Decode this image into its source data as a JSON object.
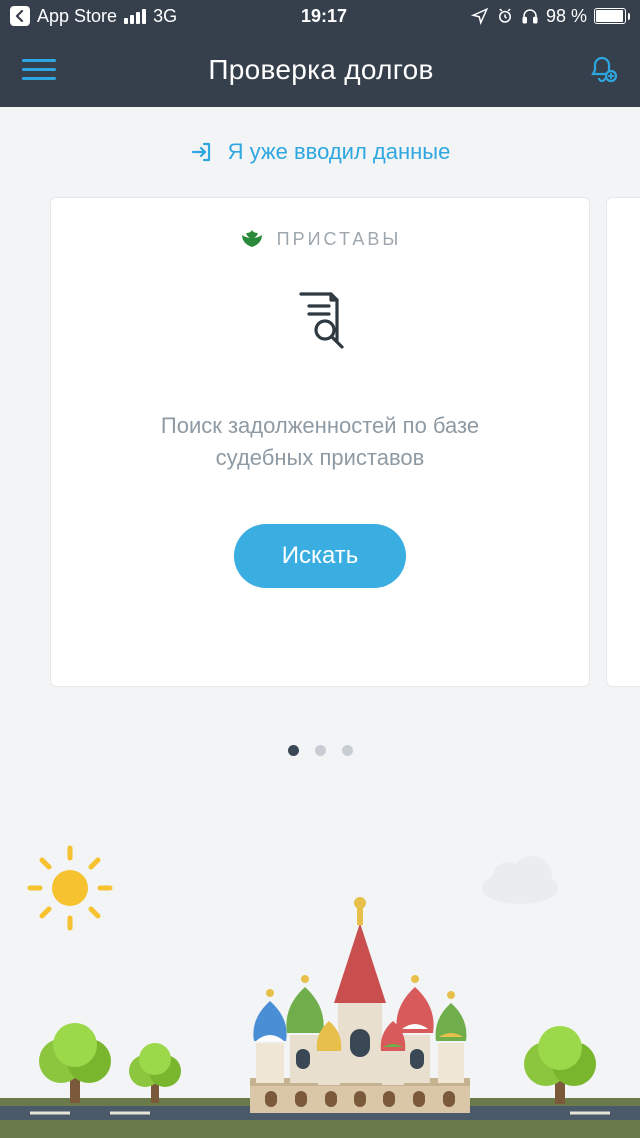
{
  "status": {
    "back_label": "App Store",
    "network": "3G",
    "time": "19:17",
    "battery_pct": "98 %"
  },
  "nav": {
    "title": "Проверка долгов"
  },
  "already_link": {
    "label": "Я уже вводил данные"
  },
  "card": {
    "category": "ПРИСТАВЫ",
    "description_line1": "Поиск задолженностей по базе",
    "description_line2": "судебных приставов",
    "button": "Искать"
  },
  "pager": {
    "count": 3,
    "active_index": 0
  },
  "colors": {
    "accent": "#2ea7e0",
    "navbg": "#36404d"
  }
}
